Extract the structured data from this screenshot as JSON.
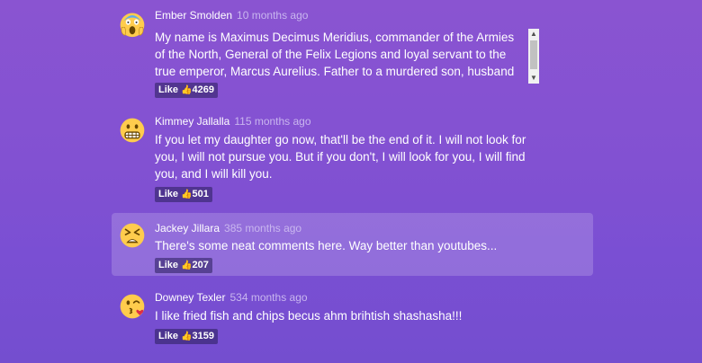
{
  "comments": [
    {
      "author": "Ember Smolden",
      "time": "10 months ago",
      "text": "My name is Maximus Decimus Meridius, commander of the Armies of the North, General of the Felix Legions and loyal servant to the true emperor, Marcus Aurelius. Father to a murdered son, husband to a murdered wife.",
      "like_label": "Like",
      "likes": "4269",
      "avatar": "screaming-face"
    },
    {
      "author": "Kimmey Jallalla",
      "time": "115 months ago",
      "text": "If you let my daughter go now, that'll be the end of it. I will not look for you, I will not pursue you. But if you don't, I will look for you, I will find you, and I will kill you.",
      "like_label": "Like",
      "likes": "501",
      "avatar": "grimacing-face"
    },
    {
      "author": "Jackey Jillara",
      "time": "385 months ago",
      "text": "There's some neat comments here. Way better than youtubes...",
      "like_label": "Like",
      "likes": "207",
      "avatar": "tired-face"
    },
    {
      "author": "Downey Texler",
      "time": "534 months ago",
      "text": "I like fried fish and chips becus ahm brihtish shashasha!!!",
      "like_label": "Like",
      "likes": "3159",
      "avatar": "kissing-heart-face"
    }
  ],
  "colors": {
    "background_top": "#8a54d1",
    "background_bottom": "#744ecf",
    "emoji_yellow": "#ffcc4d"
  }
}
